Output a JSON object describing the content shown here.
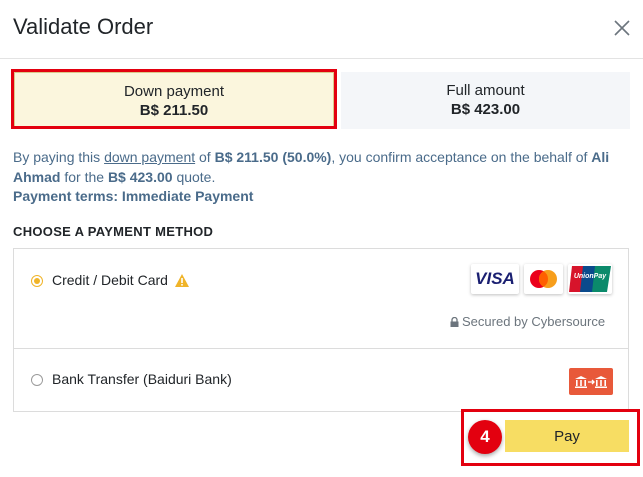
{
  "dialog": {
    "title": "Validate Order",
    "close_icon": "close-icon"
  },
  "payment_options": [
    {
      "label": "Down payment",
      "amount": "B$ 211.50",
      "selected": true
    },
    {
      "label": "Full amount",
      "amount": "B$ 423.00",
      "selected": false
    }
  ],
  "description": {
    "prefix": "By paying this",
    "link": "down payment",
    "of": "of",
    "amount": "B$ 211.50",
    "percent": "(50.0%)",
    "middle": ", you confirm acceptance on the behalf of",
    "customer": "Ali Ahmad",
    "for_the": "for the",
    "total": "B$ 423.00",
    "suffix": "quote.",
    "terms": "Payment terms: Immediate Payment"
  },
  "method_heading": "CHOOSE A PAYMENT METHOD",
  "methods": [
    {
      "label": "Credit / Debit Card",
      "selected": true,
      "warning_icon": "warning-icon",
      "logos": [
        "VISA",
        "mastercard-logo",
        "UnionPay"
      ],
      "secured_text": "Secured by Cybersource",
      "secured_icon": "lock-icon"
    },
    {
      "label": "Bank Transfer (Baiduri Bank)",
      "selected": false,
      "icon": "bank-transfer-icon"
    }
  ],
  "step_badge": "4",
  "pay_button": "Pay",
  "colors": {
    "accent_yellow": "#f7dd63",
    "radio_yellow": "#f0b429",
    "highlight_red": "#e3000f",
    "text_blue": "#4a6b8a",
    "bank_icon_bg": "#e8593a"
  }
}
